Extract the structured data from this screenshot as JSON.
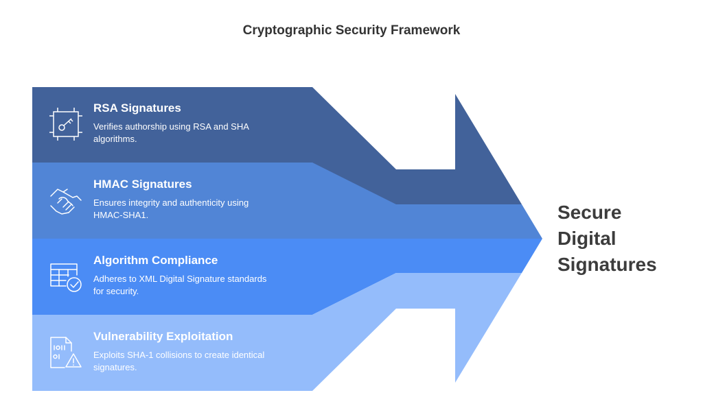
{
  "title": "Cryptographic Security Framework",
  "colors": {
    "band1": "#42629a",
    "band2": "#5185d6",
    "band3": "#4b8cf5",
    "band4": "#94bcfb",
    "text_dark": "#333333"
  },
  "bands": [
    {
      "heading": "RSA Signatures",
      "description_line1": "Verifies authorship using RSA and SHA",
      "description_line2": "algorithms.",
      "icon": "key-frame-icon"
    },
    {
      "heading": "HMAC Signatures",
      "description_line1": "Ensures integrity and authenticity using",
      "description_line2": "HMAC-SHA1.",
      "icon": "handshake-icon"
    },
    {
      "heading": "Algorithm Compliance",
      "description_line1": "Adheres to XML Digital Signature standards",
      "description_line2": "for security.",
      "icon": "table-check-icon"
    },
    {
      "heading": "Vulnerability Exploitation",
      "description_line1": "Exploits SHA-1 collisions to create identical",
      "description_line2": "signatures.",
      "icon": "file-warning-icon"
    }
  ],
  "result": {
    "line1": "Secure",
    "line2": "Digital",
    "line3": "Signatures"
  }
}
